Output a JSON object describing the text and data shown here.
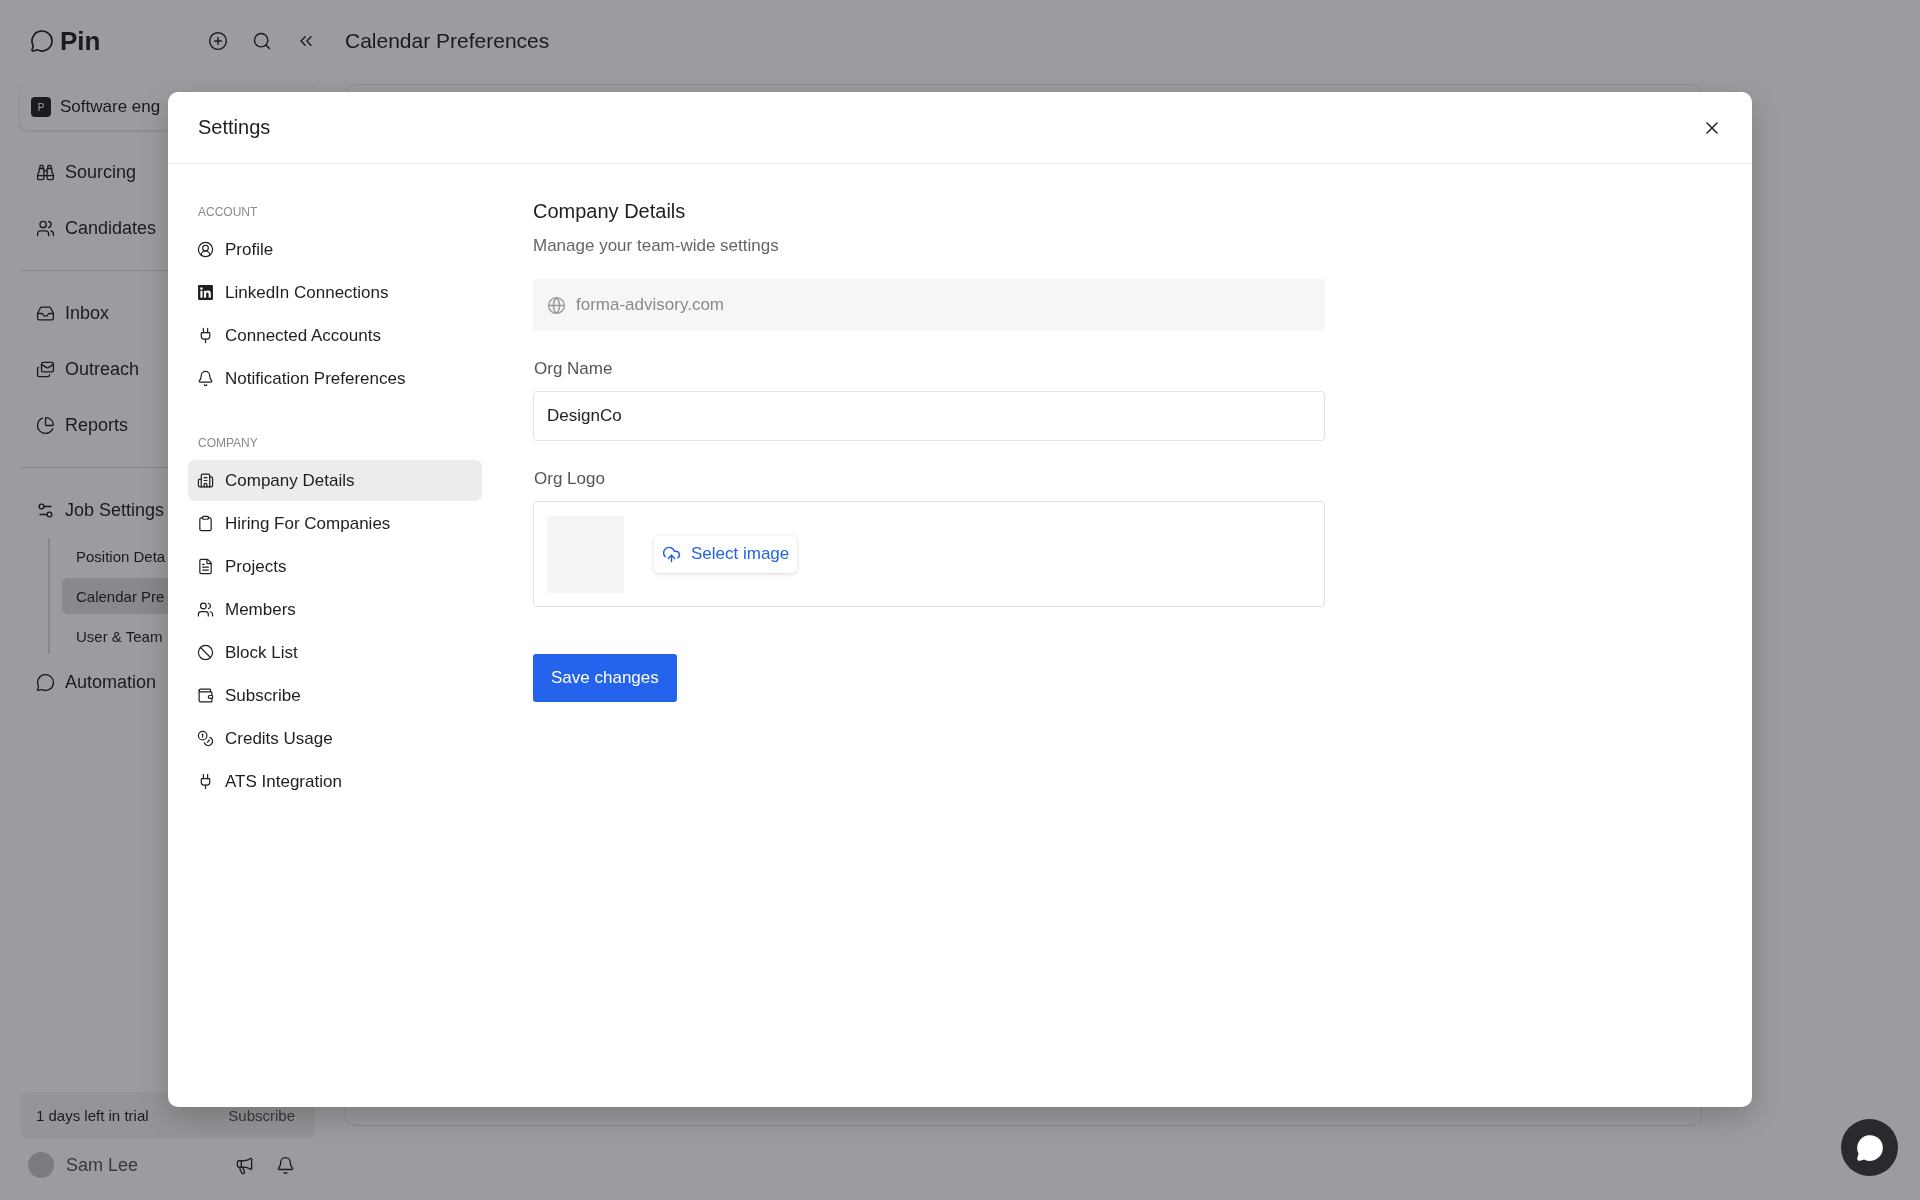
{
  "app": {
    "logo": "Pin",
    "page_title": "Calendar Preferences",
    "workspace": {
      "badge": "P",
      "name": "Software eng"
    },
    "nav_sections": [
      {
        "items": [
          {
            "label": "Sourcing"
          },
          {
            "label": "Candidates"
          }
        ]
      },
      {
        "items": [
          {
            "label": "Inbox"
          },
          {
            "label": "Outreach"
          },
          {
            "label": "Reports"
          }
        ]
      },
      {
        "items": [
          {
            "label": "Job Settings",
            "children": [
              {
                "label": "Position Deta",
                "selected": false
              },
              {
                "label": "Calendar Pre",
                "selected": true
              },
              {
                "label": "User & Team",
                "selected": false
              }
            ]
          },
          {
            "label": "Automation"
          }
        ]
      }
    ],
    "trial": {
      "text": "1 days left in trial",
      "action": "Subscribe"
    },
    "user": {
      "name": "Sam Lee"
    }
  },
  "settings_dialog": {
    "title": "Settings",
    "nav_groups": [
      {
        "heading": "ACCOUNT",
        "items": [
          {
            "label": "Profile",
            "selected": false
          },
          {
            "label": "LinkedIn Connections",
            "selected": false
          },
          {
            "label": "Connected Accounts",
            "selected": false
          },
          {
            "label": "Notification Preferences",
            "selected": false
          }
        ]
      },
      {
        "heading": "COMPANY",
        "items": [
          {
            "label": "Company Details",
            "selected": true
          },
          {
            "label": "Hiring For Companies",
            "selected": false
          },
          {
            "label": "Projects",
            "selected": false
          },
          {
            "label": "Members",
            "selected": false
          },
          {
            "label": "Block List",
            "selected": false
          },
          {
            "label": "Subscribe",
            "selected": false
          },
          {
            "label": "Credits Usage",
            "selected": false
          },
          {
            "label": "ATS Integration",
            "selected": false
          }
        ]
      }
    ],
    "content": {
      "title": "Company Details",
      "subtitle": "Manage your team-wide settings",
      "domain_field": {
        "value": "forma-advisory.com",
        "disabled": true
      },
      "org_name": {
        "label": "Org Name",
        "value": "DesignCo"
      },
      "org_logo": {
        "label": "Org Logo",
        "button": "Select image"
      },
      "save_button": "Save changes"
    }
  }
}
